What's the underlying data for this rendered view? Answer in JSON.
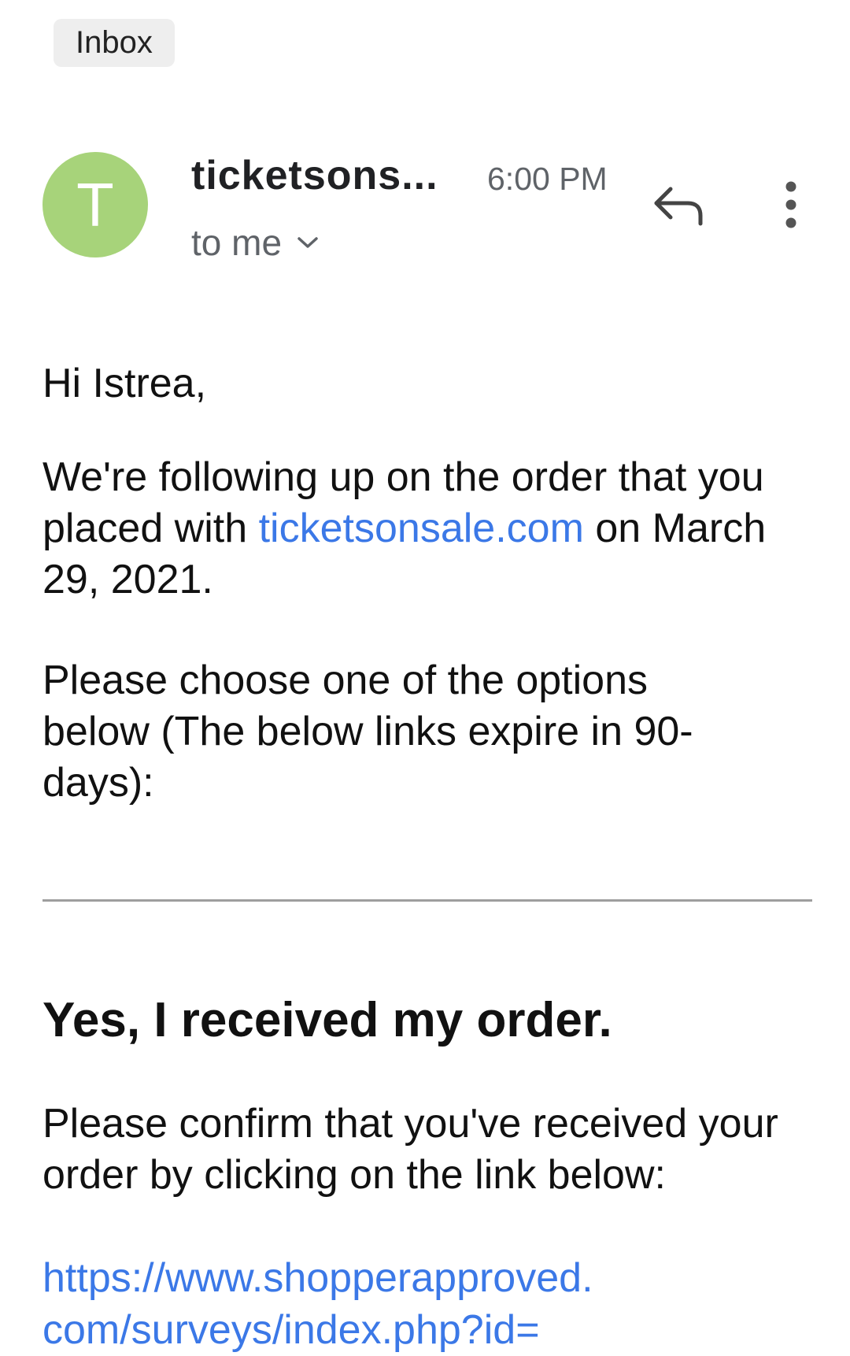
{
  "label": {
    "text": "Inbox"
  },
  "header": {
    "avatar_letter": "T",
    "sender": "ticketsons...",
    "time": "6:00 PM",
    "recipient": "to me"
  },
  "body": {
    "greeting": "Hi Istrea,",
    "para1_before": "We're following up on the order that you placed with ",
    "para1_link": "ticketsonsale.com",
    "para1_after": " on March 29, 2021.",
    "para2": "Please choose one of the options below (The below links expire in 90-days):",
    "heading": "Yes, I received my order.",
    "para3": "Please confirm that you've received your order by clicking on the link below:",
    "survey_link_line1": "https://www.shopperapproved.",
    "survey_link_line2": "com/surveys/index.php?id="
  },
  "icons": {
    "reply": "reply-arrow-icon",
    "more": "more-vertical-icon",
    "expand": "chevron-down-icon"
  },
  "colors": {
    "avatar": "#a7d37a",
    "link": "#3b78e7",
    "chip": "#eeeeee"
  }
}
